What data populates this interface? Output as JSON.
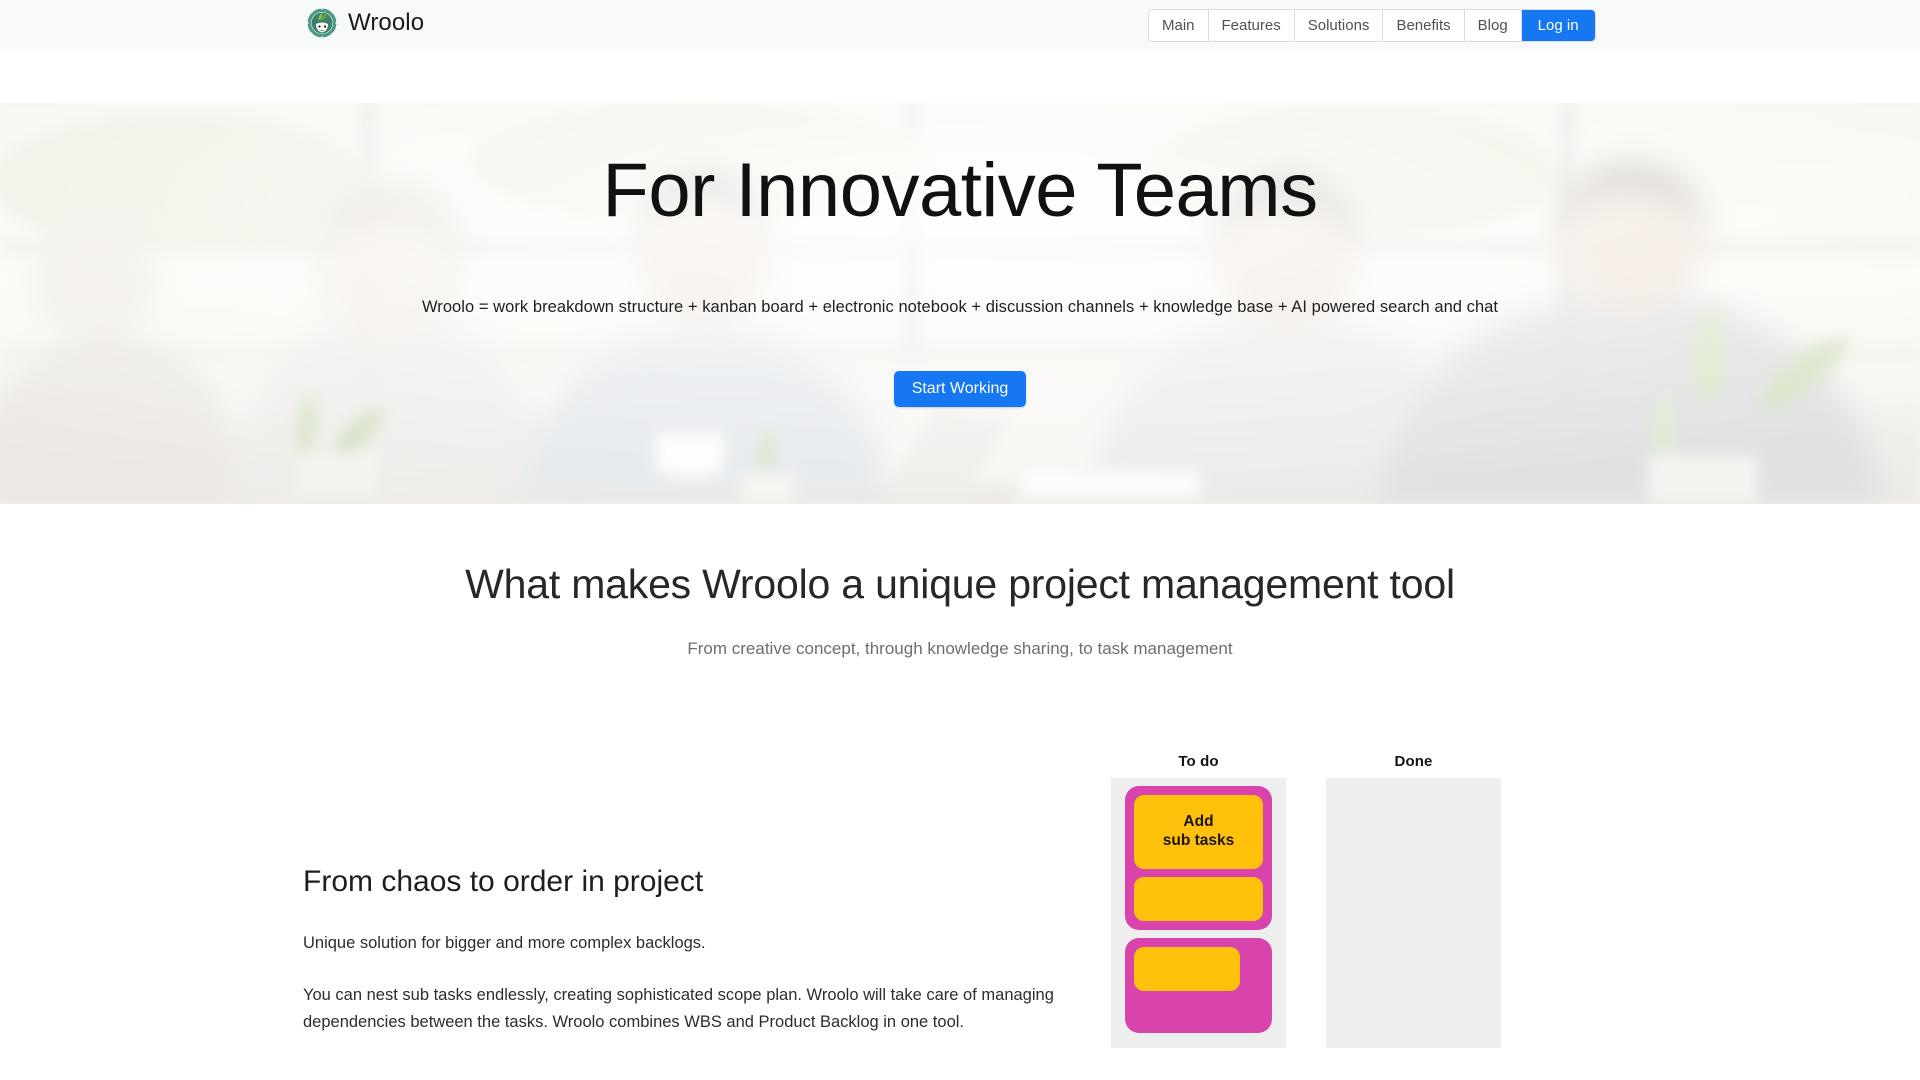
{
  "header": {
    "brand": {
      "name": "Wroolo",
      "logo_icon": "wroolo-gear-face-icon",
      "logo_color": "#4c9a85"
    },
    "nav": [
      {
        "label": "Main",
        "primary": false
      },
      {
        "label": "Features",
        "primary": false
      },
      {
        "label": "Solutions",
        "primary": false
      },
      {
        "label": "Benefits",
        "primary": false
      },
      {
        "label": "Blog",
        "primary": false
      },
      {
        "label": "Log in",
        "primary": true
      }
    ],
    "background": "#f7f9fb",
    "accent": "#1577f2"
  },
  "hero": {
    "title": "For Innovative Teams",
    "subtitle": "Wroolo = work breakdown structure + kanban board + electronic notebook + discussion channels + knowledge base + AI powered search and chat",
    "cta_label": "Start Working",
    "cta_color": "#1577f2"
  },
  "intro": {
    "title": "What makes Wroolo a unique project management tool",
    "subtitle": "From creative concept, through knowledge sharing, to task management"
  },
  "feature": {
    "heading": "From chaos to order in project",
    "lead": "Unique solution for bigger and more complex backlogs.",
    "body": "You can nest sub tasks endlessly, creating sophisticated scope plan. Wroolo will take care of managing dependencies between the tasks. Wroolo combines WBS and Product Backlog in one tool."
  },
  "kanban": {
    "colors": {
      "group": "#d944ac",
      "card": "#ffc10b",
      "column": "#eeeeee"
    },
    "columns": [
      {
        "title": "To do",
        "groups": [
          {
            "cards": [
              {
                "text": "Add\nsub tasks",
                "tall": true
              },
              {
                "text": "",
                "tall": false
              }
            ]
          },
          {
            "cards": [
              {
                "text": "",
                "tall": false
              }
            ],
            "deep": true
          }
        ]
      },
      {
        "title": "Done",
        "groups": []
      }
    ]
  }
}
